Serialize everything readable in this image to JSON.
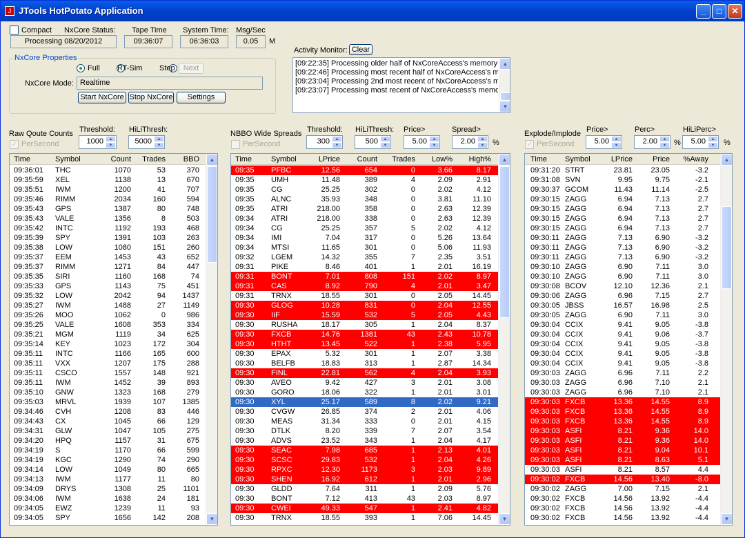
{
  "window": {
    "title": "JTools HotPotato Application",
    "min": "_",
    "max": "□",
    "close": "✕"
  },
  "status": {
    "compact_label": "Compact",
    "nxcore_status_label": "NxCore Status:",
    "nxcore_status_value": "Processing 08/20/2012",
    "tape_time_label": "Tape Time",
    "tape_time_value": "09:36:07",
    "system_time_label": "System Time:",
    "system_time_value": "06:36:03",
    "msgsec_label": "Msg/Sec",
    "msgsec_value": "0.05",
    "msgsec_unit": "M"
  },
  "props": {
    "group_label": "NxCore Properties",
    "full": "Full",
    "rtsim": "RT-Sim",
    "step": "Step",
    "next": "Next",
    "mode_label": "NxCore Mode:",
    "mode_value": "Realtime",
    "start": "Start NxCore",
    "stop": "Stop NxCore",
    "settings": "Settings"
  },
  "activity": {
    "label": "Activity Monitor:",
    "clear": "Clear",
    "lines": [
      "[09:22:35] Processing older half of NxCoreAccess's memory bu",
      "[09:22:46] Processing most recent half of NxCoreAccess's mer",
      "[09:23:04] Processing 2nd most recent of NxCoreAccess's mer",
      "[09:23:07] Processing most recent of NxCoreAccess's memory"
    ]
  },
  "raw": {
    "title": "Raw Qoute Counts",
    "persecond": "PerSecond",
    "threshold_label": "Threshold:",
    "threshold": "1000",
    "hili_label": "HiLiThresh:",
    "hili": "5000",
    "headers": [
      "Time",
      "Symbol",
      "Count",
      "Trades",
      "BBO"
    ],
    "rows": [
      [
        "09:36:01",
        "THC",
        "1070",
        "53",
        "370"
      ],
      [
        "09:35:59",
        "XEL",
        "1138",
        "13",
        "670"
      ],
      [
        "09:35:51",
        "IWM",
        "1200",
        "41",
        "707"
      ],
      [
        "09:35:46",
        "RIMM",
        "2034",
        "160",
        "594"
      ],
      [
        "09:35:43",
        "GPS",
        "1387",
        "80",
        "748"
      ],
      [
        "09:35:43",
        "VALE",
        "1356",
        "8",
        "503"
      ],
      [
        "09:35:42",
        "INTC",
        "1192",
        "193",
        "468"
      ],
      [
        "09:35:39",
        "SPY",
        "1391",
        "103",
        "263"
      ],
      [
        "09:35:38",
        "LOW",
        "1080",
        "151",
        "260"
      ],
      [
        "09:35:37",
        "EEM",
        "1453",
        "43",
        "652"
      ],
      [
        "09:35:37",
        "RIMM",
        "1271",
        "84",
        "447"
      ],
      [
        "09:35:35",
        "SIRI",
        "1160",
        "168",
        "74"
      ],
      [
        "09:35:33",
        "GPS",
        "1143",
        "75",
        "451"
      ],
      [
        "09:35:32",
        "LOW",
        "2042",
        "94",
        "1437"
      ],
      [
        "09:35:27",
        "IWM",
        "1488",
        "27",
        "1149"
      ],
      [
        "09:35:26",
        "MOO",
        "1062",
        "0",
        "986"
      ],
      [
        "09:35:25",
        "VALE",
        "1608",
        "353",
        "334"
      ],
      [
        "09:35:21",
        "MGM",
        "1119",
        "34",
        "625"
      ],
      [
        "09:35:14",
        "KEY",
        "1023",
        "172",
        "304"
      ],
      [
        "09:35:11",
        "INTC",
        "1166",
        "165",
        "600"
      ],
      [
        "09:35:11",
        "VXX",
        "1207",
        "175",
        "288"
      ],
      [
        "09:35:11",
        "CSCO",
        "1557",
        "148",
        "921"
      ],
      [
        "09:35:11",
        "IWM",
        "1452",
        "39",
        "893"
      ],
      [
        "09:35:10",
        "GNW",
        "1323",
        "168",
        "279"
      ],
      [
        "09:35:03",
        "MRVL",
        "1939",
        "107",
        "1385"
      ],
      [
        "09:34:46",
        "CVH",
        "1208",
        "83",
        "446"
      ],
      [
        "09:34:43",
        "CX",
        "1045",
        "66",
        "129"
      ],
      [
        "09:34:31",
        "GLW",
        "1047",
        "105",
        "275"
      ],
      [
        "09:34:20",
        "HPQ",
        "1157",
        "31",
        "675"
      ],
      [
        "09:34:19",
        "S",
        "1170",
        "66",
        "599"
      ],
      [
        "09:34:19",
        "KGC",
        "1290",
        "74",
        "290"
      ],
      [
        "09:34:14",
        "LOW",
        "1049",
        "80",
        "665"
      ],
      [
        "09:34:13",
        "IWM",
        "1177",
        "11",
        "80"
      ],
      [
        "09:34:09",
        "DRYS",
        "1308",
        "25",
        "1101"
      ],
      [
        "09:34:06",
        "IWM",
        "1638",
        "24",
        "181"
      ],
      [
        "09:34:05",
        "EWZ",
        "1239",
        "11",
        "93"
      ],
      [
        "09:34:05",
        "SPY",
        "1656",
        "142",
        "208"
      ]
    ]
  },
  "nbbo": {
    "title": "NBBO Wide Spreads",
    "persecond": "PerSecond",
    "threshold_label": "Threshold:",
    "threshold": "300",
    "hili_label": "HiLiThresh:",
    "hili": "500",
    "price_label": "Price>",
    "price": "5.00",
    "spread_label": "Spread>",
    "spread": "2.00",
    "pct": "%",
    "headers": [
      "Time",
      "Symbol",
      "LPrice",
      "Count",
      "Trades",
      "Low%",
      "High%"
    ],
    "rows": [
      [
        "09:35",
        "PFBC",
        "12.56",
        "654",
        "0",
        "3.66",
        "8.17",
        "red"
      ],
      [
        "09:35",
        "UMH",
        "11.48",
        "389",
        "4",
        "2.09",
        "2.91",
        ""
      ],
      [
        "09:35",
        "CG",
        "25.25",
        "302",
        "0",
        "2.02",
        "4.12",
        ""
      ],
      [
        "09:35",
        "ALNC",
        "35.93",
        "348",
        "0",
        "3.81",
        "11.10",
        ""
      ],
      [
        "09:35",
        "ATRI",
        "218.00",
        "358",
        "0",
        "2.63",
        "12.39",
        ""
      ],
      [
        "09:34",
        "ATRI",
        "218.00",
        "338",
        "0",
        "2.63",
        "12.39",
        ""
      ],
      [
        "09:34",
        "CG",
        "25.25",
        "357",
        "5",
        "2.02",
        "4.12",
        ""
      ],
      [
        "09:34",
        "IMI",
        "7.04",
        "317",
        "0",
        "5.26",
        "13.64",
        ""
      ],
      [
        "09:34",
        "MTSI",
        "11.65",
        "301",
        "0",
        "5.06",
        "11.93",
        ""
      ],
      [
        "09:32",
        "LGEM",
        "14.32",
        "355",
        "7",
        "2.35",
        "3.51",
        ""
      ],
      [
        "09:31",
        "PIKE",
        "8.46",
        "401",
        "1",
        "2.01",
        "16.19",
        ""
      ],
      [
        "09:31",
        "BONT",
        "7.01",
        "808",
        "151",
        "2.02",
        "8.97",
        "red"
      ],
      [
        "09:31",
        "CAS",
        "8.92",
        "790",
        "4",
        "2.01",
        "3.47",
        "red"
      ],
      [
        "09:31",
        "TRNX",
        "18.55",
        "301",
        "0",
        "2.05",
        "14.45",
        ""
      ],
      [
        "09:30",
        "GLOG",
        "10.28",
        "831",
        "0",
        "2.04",
        "12.55",
        "red"
      ],
      [
        "09:30",
        "IIF",
        "15.59",
        "532",
        "5",
        "2.05",
        "4.43",
        "red"
      ],
      [
        "09:30",
        "RUSHA",
        "18.17",
        "305",
        "1",
        "2.04",
        "8.37",
        ""
      ],
      [
        "09:30",
        "FXCB",
        "14.76",
        "1381",
        "43",
        "2.43",
        "10.78",
        "red"
      ],
      [
        "09:30",
        "HTHT",
        "13.45",
        "522",
        "1",
        "2.38",
        "5.95",
        "red"
      ],
      [
        "09:30",
        "EPAX",
        "5.32",
        "301",
        "1",
        "2.07",
        "3.38",
        ""
      ],
      [
        "09:30",
        "BELFB",
        "18.83",
        "313",
        "1",
        "2.87",
        "14.34",
        ""
      ],
      [
        "09:30",
        "FINL",
        "22.81",
        "562",
        "4",
        "2.04",
        "3.93",
        "red"
      ],
      [
        "09:30",
        "AVEO",
        "9.42",
        "427",
        "3",
        "2.01",
        "3.08",
        ""
      ],
      [
        "09:30",
        "GORO",
        "18.06",
        "322",
        "1",
        "2.01",
        "3.01",
        ""
      ],
      [
        "09:30",
        "XYL",
        "25.17",
        "589",
        "8",
        "2.02",
        "9.21",
        "sel"
      ],
      [
        "09:30",
        "CVGW",
        "26.85",
        "374",
        "2",
        "2.01",
        "4.06",
        ""
      ],
      [
        "09:30",
        "MEAS",
        "31.34",
        "333",
        "0",
        "2.01",
        "4.15",
        ""
      ],
      [
        "09:30",
        "DTLK",
        "8.20",
        "339",
        "7",
        "2.07",
        "3.54",
        ""
      ],
      [
        "09:30",
        "ADVS",
        "23.52",
        "343",
        "1",
        "2.04",
        "4.17",
        ""
      ],
      [
        "09:30",
        "SEAC",
        "7.98",
        "685",
        "1",
        "2.13",
        "4.01",
        "red"
      ],
      [
        "09:30",
        "SCSC",
        "29.83",
        "532",
        "1",
        "2.04",
        "4.26",
        "red"
      ],
      [
        "09:30",
        "RPXC",
        "12.30",
        "1173",
        "3",
        "2.03",
        "9.89",
        "red"
      ],
      [
        "09:30",
        "SHEN",
        "16.92",
        "612",
        "1",
        "2.01",
        "2.96",
        "red"
      ],
      [
        "09:30",
        "GLDD",
        "7.64",
        "311",
        "1",
        "2.09",
        "5.76",
        ""
      ],
      [
        "09:30",
        "BONT",
        "7.12",
        "413",
        "43",
        "2.03",
        "8.97",
        ""
      ],
      [
        "09:30",
        "CWEI",
        "49.33",
        "547",
        "1",
        "2.41",
        "4.82",
        "red"
      ],
      [
        "09:30",
        "TRNX",
        "18.55",
        "393",
        "1",
        "7.06",
        "14.45",
        ""
      ]
    ]
  },
  "explode": {
    "title": "Explode/Implode",
    "persecond": "PerSecond",
    "price_label": "Price>",
    "price": "5.00",
    "perc_label": "Perc>",
    "perc": "2.00",
    "pct": "%",
    "hili_label": "HiLiPerc>",
    "hili": "5.00",
    "pct2": "%",
    "headers": [
      "Time",
      "Symbol",
      "LPrice",
      "Price",
      "%Away"
    ],
    "rows": [
      [
        "09:31:20",
        "STRT",
        "23.81",
        "23.05",
        "-3.2",
        ""
      ],
      [
        "09:31:08",
        "SVN",
        "9.95",
        "9.75",
        "-2.1",
        ""
      ],
      [
        "09:30:37",
        "GCOM",
        "11.43",
        "11.14",
        "-2.5",
        ""
      ],
      [
        "09:30:15",
        "ZAGG",
        "6.94",
        "7.13",
        "2.7",
        ""
      ],
      [
        "09:30:15",
        "ZAGG",
        "6.94",
        "7.13",
        "2.7",
        ""
      ],
      [
        "09:30:15",
        "ZAGG",
        "6.94",
        "7.13",
        "2.7",
        ""
      ],
      [
        "09:30:15",
        "ZAGG",
        "6.94",
        "7.13",
        "2.7",
        ""
      ],
      [
        "09:30:11",
        "ZAGG",
        "7.13",
        "6.90",
        "-3.2",
        ""
      ],
      [
        "09:30:11",
        "ZAGG",
        "7.13",
        "6.90",
        "-3.2",
        ""
      ],
      [
        "09:30:11",
        "ZAGG",
        "7.13",
        "6.90",
        "-3.2",
        ""
      ],
      [
        "09:30:10",
        "ZAGG",
        "6.90",
        "7.11",
        "3.0",
        ""
      ],
      [
        "09:30:10",
        "ZAGG",
        "6.90",
        "7.11",
        "3.0",
        ""
      ],
      [
        "09:30:08",
        "BCOV",
        "12.10",
        "12.36",
        "2.1",
        ""
      ],
      [
        "09:30:06",
        "ZAGG",
        "6.96",
        "7.15",
        "2.7",
        ""
      ],
      [
        "09:30:05",
        "JBSS",
        "16.57",
        "16.98",
        "2.5",
        ""
      ],
      [
        "09:30:05",
        "ZAGG",
        "6.90",
        "7.11",
        "3.0",
        ""
      ],
      [
        "09:30:04",
        "CCIX",
        "9.41",
        "9.05",
        "-3.8",
        ""
      ],
      [
        "09:30:04",
        "CCIX",
        "9.41",
        "9.06",
        "-3.7",
        ""
      ],
      [
        "09:30:04",
        "CCIX",
        "9.41",
        "9.05",
        "-3.8",
        ""
      ],
      [
        "09:30:04",
        "CCIX",
        "9.41",
        "9.05",
        "-3.8",
        ""
      ],
      [
        "09:30:04",
        "CCIX",
        "9.41",
        "9.05",
        "-3.8",
        ""
      ],
      [
        "09:30:03",
        "ZAGG",
        "6.96",
        "7.11",
        "2.2",
        ""
      ],
      [
        "09:30:03",
        "ZAGG",
        "6.96",
        "7.10",
        "2.1",
        ""
      ],
      [
        "09:30:03",
        "ZAGG",
        "6.96",
        "7.10",
        "2.1",
        ""
      ],
      [
        "09:30:03",
        "FXCB",
        "13.36",
        "14.55",
        "8.9",
        "red"
      ],
      [
        "09:30:03",
        "FXCB",
        "13.36",
        "14.55",
        "8.9",
        "red"
      ],
      [
        "09:30:03",
        "FXCB",
        "13.36",
        "14.55",
        "8.9",
        "red"
      ],
      [
        "09:30:03",
        "ASFI",
        "8.21",
        "9.36",
        "14.0",
        "red"
      ],
      [
        "09:30:03",
        "ASFI",
        "8.21",
        "9.36",
        "14.0",
        "red"
      ],
      [
        "09:30:03",
        "ASFI",
        "8.21",
        "9.04",
        "10.1",
        "red"
      ],
      [
        "09:30:03",
        "ASFI",
        "8.21",
        "8.63",
        "5.1",
        "red"
      ],
      [
        "09:30:03",
        "ASFI",
        "8.21",
        "8.57",
        "4.4",
        ""
      ],
      [
        "09:30:02",
        "FXCB",
        "14.56",
        "13.40",
        "-8.0",
        "red"
      ],
      [
        "09:30:02",
        "ZAGG",
        "7.00",
        "7.15",
        "2.1",
        ""
      ],
      [
        "09:30:02",
        "FXCB",
        "14.56",
        "13.92",
        "-4.4",
        ""
      ],
      [
        "09:30:02",
        "FXCB",
        "14.56",
        "13.92",
        "-4.4",
        ""
      ],
      [
        "09:30:02",
        "FXCB",
        "14.56",
        "13.92",
        "-4.4",
        ""
      ]
    ]
  },
  "colors": {
    "highlight": "#ff0000",
    "selected": "#316ac5",
    "title_bar": "#0054e3"
  }
}
